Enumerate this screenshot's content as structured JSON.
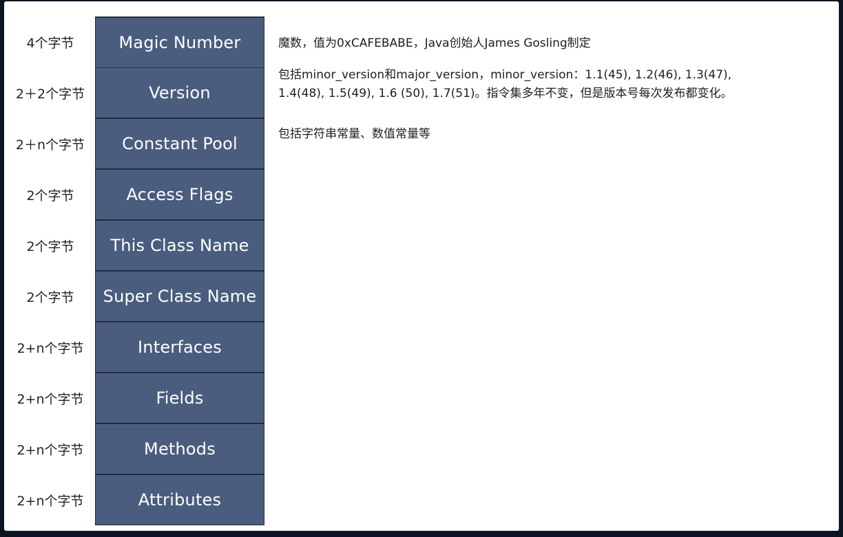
{
  "rows": [
    {
      "size": "4个字节",
      "name": "Magic Number"
    },
    {
      "size": "2＋2个字节",
      "name": "Version"
    },
    {
      "size": "2＋n个字节",
      "name": "Constant Pool"
    },
    {
      "size": "2个字节",
      "name": "Access Flags"
    },
    {
      "size": "2个字节",
      "name": "This Class Name"
    },
    {
      "size": "2个字节",
      "name": "Super Class Name"
    },
    {
      "size": "2+n个字节",
      "name": "Interfaces"
    },
    {
      "size": "2+n个字节",
      "name": "Fields"
    },
    {
      "size": "2+n个字节",
      "name": "Methods"
    },
    {
      "size": "2+n个字节",
      "name": "Attributes"
    }
  ],
  "descriptions": {
    "magic": "魔数，值为0xCAFEBABE，Java创始人James Gosling制定",
    "version_line1": "包括minor_version和major_version，minor_version：1.1(45), 1.2(46), 1.3(47),",
    "version_line2": "1.4(48), 1.5(49), 1.6 (50), 1.7(51)。指令集多年不变，但是版本号每次发布都变化。",
    "constant_pool": "包括字符串常量、数值常量等"
  },
  "colors": {
    "block": "#4a5d7e",
    "block_border": "#1f2a3c",
    "background": "#0c1322"
  }
}
